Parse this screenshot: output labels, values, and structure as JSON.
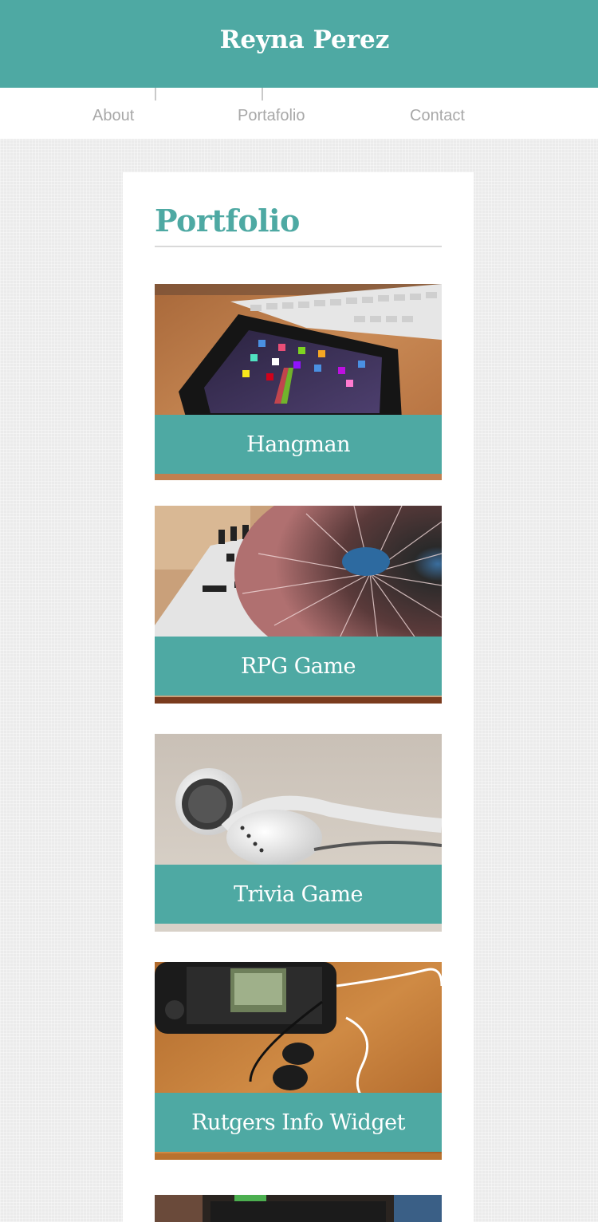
{
  "header": {
    "site_title": "Reyna Perez"
  },
  "nav": {
    "items": [
      {
        "label": "About"
      },
      {
        "label": "Portafolio"
      },
      {
        "label": "Contact"
      }
    ]
  },
  "main": {
    "section_title": "Portfolio",
    "projects": [
      {
        "title": "Hangman",
        "image": "ipad-on-desk-photo"
      },
      {
        "title": "RPG Game",
        "image": "dj-turntable-photo"
      },
      {
        "title": "Trivia Game",
        "image": "earbuds-photo"
      },
      {
        "title": "Rutgers Info Widget",
        "image": "iphone-with-earphones-photo"
      },
      {
        "title": "",
        "image": "bookshelf-monitor-photo"
      }
    ]
  },
  "colors": {
    "accent": "#4ea9a3",
    "nav_text": "#a8a8a8",
    "page_background": "#ebebeb",
    "card_background": "#ffffff"
  }
}
